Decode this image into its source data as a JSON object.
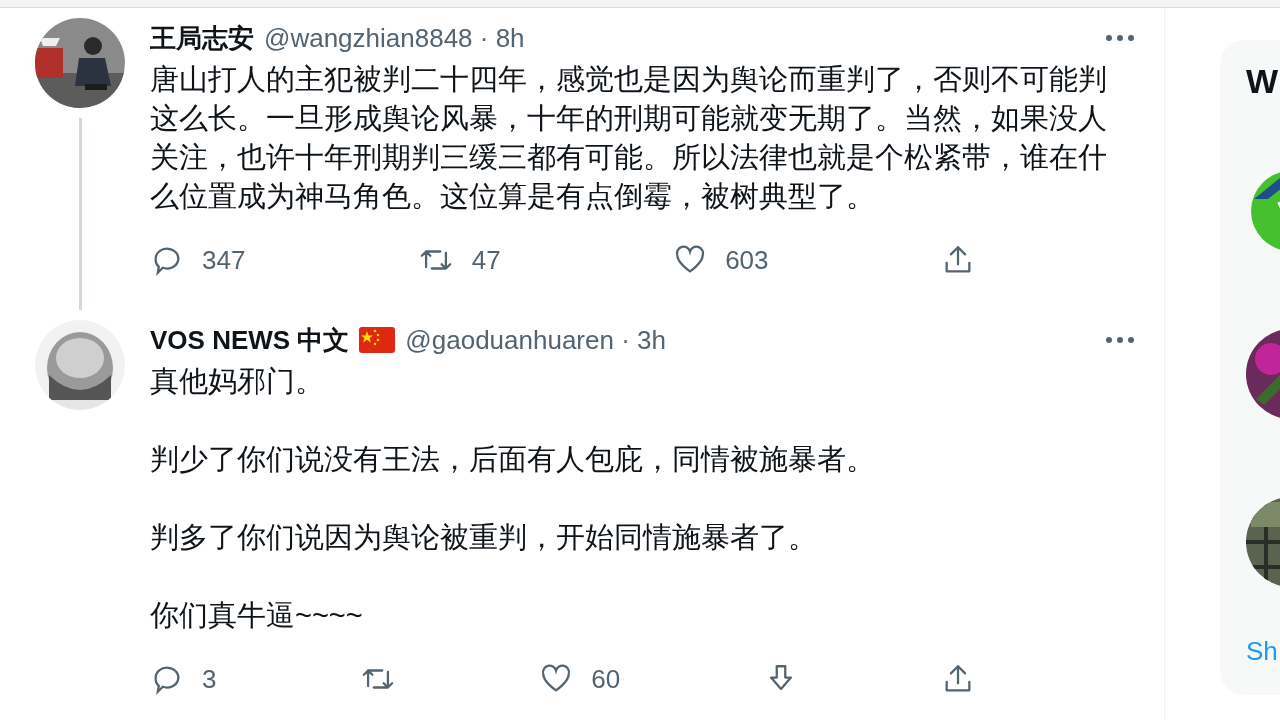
{
  "tweets": [
    {
      "name": "王局志安",
      "flag": false,
      "handle": "@wangzhian8848",
      "time": "· 8h",
      "thread_line": true,
      "paragraphs": [
        "唐山打人的主犯被判二十四年，感觉也是因为舆论而重判了，否则不可能判这么长。一旦形成舆论风暴，十年的刑期可能就变无期了。当然，如果没人关注，也许十年刑期判三缓三都有可能。所以法律也就是个松紧带，谁在什么位置成为神马角色。这位算是有点倒霉，被树典型了。"
      ],
      "actions": [
        {
          "kind": "reply",
          "count": "347"
        },
        {
          "kind": "retweet",
          "count": "47"
        },
        {
          "kind": "like",
          "count": "603"
        },
        {
          "kind": "share"
        }
      ]
    },
    {
      "name": "VOS NEWS 中文",
      "flag": true,
      "handle": "@gaoduanhuaren",
      "time": "· 3h",
      "thread_line": false,
      "paragraphs": [
        "真他妈邪门。",
        "判少了你们说没有王法，后面有人包庇，同情被施暴者。",
        "判多了你们说因为舆论被重判，开始同情施暴者了。",
        "你们真牛逼~~~~"
      ],
      "actions": [
        {
          "kind": "reply",
          "count": "3"
        },
        {
          "kind": "retweet"
        },
        {
          "kind": "like",
          "count": "60"
        },
        {
          "kind": "downvote"
        },
        {
          "kind": "share"
        }
      ]
    }
  ],
  "sidebar": {
    "heading": "W",
    "suggestions": [
      {
        "kind": "logo"
      },
      {
        "kind": "picture"
      },
      {
        "kind": "picture"
      }
    ],
    "link": "Sh"
  }
}
